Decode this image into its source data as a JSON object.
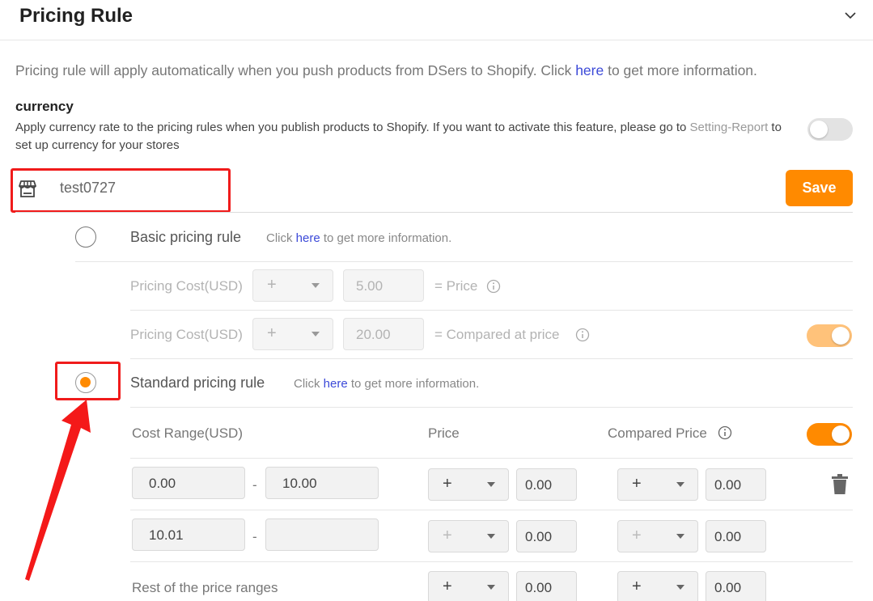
{
  "header": {
    "title": "Pricing Rule",
    "collapse_icon": "chevron-down-icon"
  },
  "intro": {
    "text_before": "Pricing rule will apply automatically when you push products from DSers to Shopify. Click ",
    "link": "here",
    "text_after": " to get more information."
  },
  "currency": {
    "title": "currency",
    "desc_before": "Apply currency rate to the pricing rules when you publish products to Shopify. If you want to activate this feature, please go to ",
    "desc_link": "Setting-Report",
    "desc_after": " to set up currency for your stores",
    "toggle_on": false
  },
  "store": {
    "icon": "store-icon",
    "name": "test0727",
    "save_label": "Save"
  },
  "basic_rule": {
    "title": "Basic pricing rule",
    "help_before": "Click ",
    "help_link": "here",
    "help_after": " to get more information.",
    "selected": false,
    "rows": [
      {
        "label": "Pricing Cost(USD)",
        "operator": "+",
        "value": "5.00",
        "result": "= Price"
      },
      {
        "label": "Pricing Cost(USD)",
        "operator": "+",
        "value": "20.00",
        "result": "= Compared at price",
        "toggle_on": true
      }
    ]
  },
  "standard_rule": {
    "title": "Standard pricing rule",
    "help_before": "Click ",
    "help_link": "here",
    "help_after": " to get more information.",
    "selected": true,
    "columns": {
      "cost_range": "Cost Range(USD)",
      "price": "Price",
      "compared_price": "Compared Price"
    },
    "compared_toggle_on": true,
    "ranges": [
      {
        "from": "0.00",
        "to": "10.00",
        "price_op": "+",
        "price_val": "0.00",
        "cmp_op": "+",
        "cmp_val": "0.00"
      },
      {
        "from": "10.01",
        "to": "",
        "price_op": "+",
        "price_val": "0.00",
        "cmp_op": "+",
        "cmp_val": "0.00"
      }
    ],
    "rest": {
      "label": "Rest of the price ranges",
      "price_op": "+",
      "price_val": "0.00",
      "cmp_op": "+",
      "cmp_val": "0.00"
    }
  },
  "colors": {
    "accent": "#ff8a00",
    "link": "#3b49d8",
    "highlight": "#f01b1b"
  }
}
